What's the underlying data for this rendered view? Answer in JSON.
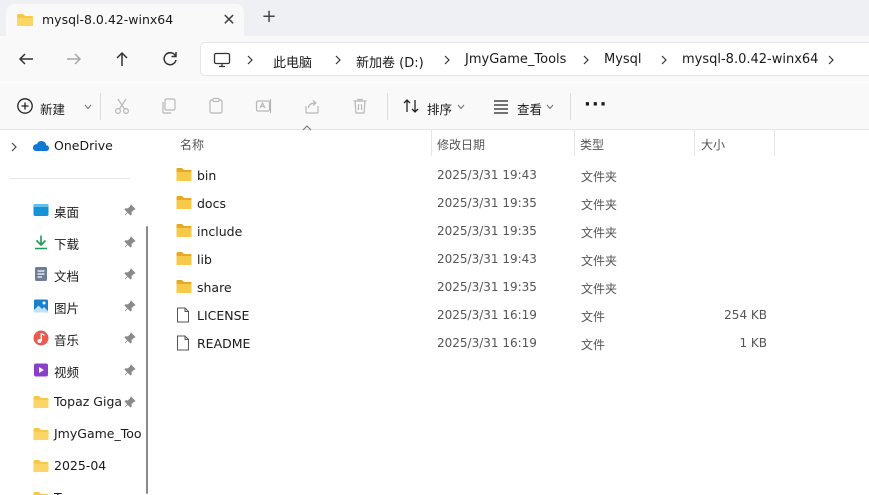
{
  "tab": {
    "title": "mysql-8.0.42-winx64",
    "close_glyph": "✕",
    "new_glyph": "+"
  },
  "nav": {
    "buttons": [
      "back-arrow-icon",
      "forward-arrow-icon",
      "up-arrow-icon",
      "refresh-icon"
    ],
    "breadcrumbs": [
      "此电脑",
      "新加卷 (D:)",
      "JmyGame_Tools",
      "Mysql",
      "mysql-8.0.42-winx64"
    ]
  },
  "toolbar": {
    "new_label": "新建",
    "sort_label": "排序",
    "view_label": "查看",
    "more_glyph": "···",
    "icons": [
      "cut-icon",
      "copy-icon",
      "paste-icon",
      "rename-icon",
      "share-icon",
      "delete-icon"
    ]
  },
  "sidebar": {
    "onedrive": "OneDrive",
    "items": [
      {
        "label": "桌面",
        "icon": "desktop-icon",
        "pinned": true
      },
      {
        "label": "下载",
        "icon": "download-icon",
        "pinned": true
      },
      {
        "label": "文档",
        "icon": "documents-icon",
        "pinned": true
      },
      {
        "label": "图片",
        "icon": "pictures-icon",
        "pinned": true
      },
      {
        "label": "音乐",
        "icon": "music-icon",
        "pinned": true
      },
      {
        "label": "视频",
        "icon": "videos-icon",
        "pinned": true
      },
      {
        "label": "Topaz Giga",
        "icon": "folder-icon",
        "pinned": true
      },
      {
        "label": "JmyGame_Too",
        "icon": "folder-icon",
        "pinned": false
      },
      {
        "label": "2025-04",
        "icon": "folder-icon",
        "pinned": false
      },
      {
        "label": "T",
        "icon": "folder-icon",
        "pinned": false
      }
    ]
  },
  "columns": {
    "name": "名称",
    "date": "修改日期",
    "type": "类型",
    "size": "大小"
  },
  "files": [
    {
      "name": "bin",
      "date": "2025/3/31 19:43",
      "type": "文件夹",
      "size": "",
      "kind": "folder"
    },
    {
      "name": "docs",
      "date": "2025/3/31 19:35",
      "type": "文件夹",
      "size": "",
      "kind": "folder"
    },
    {
      "name": "include",
      "date": "2025/3/31 19:35",
      "type": "文件夹",
      "size": "",
      "kind": "folder"
    },
    {
      "name": "lib",
      "date": "2025/3/31 19:43",
      "type": "文件夹",
      "size": "",
      "kind": "folder"
    },
    {
      "name": "share",
      "date": "2025/3/31 19:35",
      "type": "文件夹",
      "size": "",
      "kind": "folder"
    },
    {
      "name": "LICENSE",
      "date": "2025/3/31 16:19",
      "type": "文件",
      "size": "254 KB",
      "kind": "file"
    },
    {
      "name": "README",
      "date": "2025/3/31 16:19",
      "type": "文件",
      "size": "1 KB",
      "kind": "file"
    }
  ],
  "colors": {
    "folder": "#f7c948",
    "folder_dark": "#e8a920",
    "accent": "#0067c0"
  }
}
